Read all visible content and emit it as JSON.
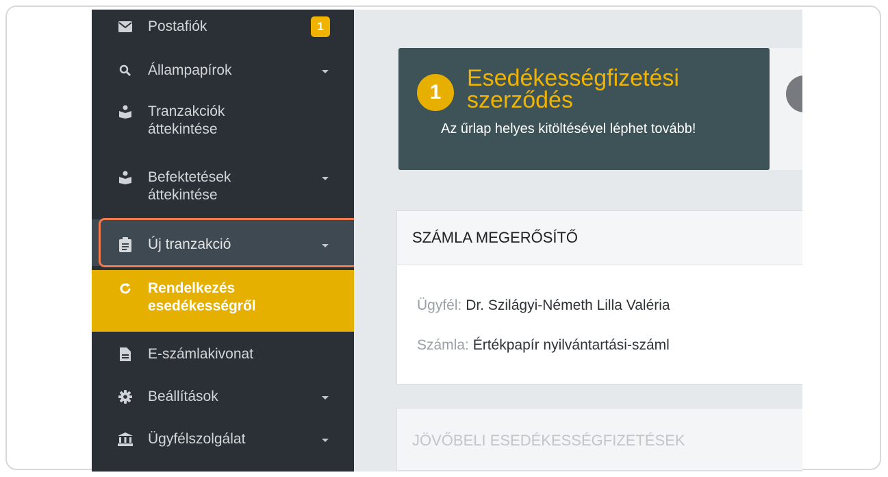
{
  "sidebar": {
    "items": [
      {
        "label": "Postafiók",
        "icon": "mail-icon",
        "badge": "1"
      },
      {
        "label": "Állampapírok",
        "icon": "search-icon",
        "has_submenu": true
      },
      {
        "label": "Tranzakciók\náttekintése",
        "icon": "person-reading-icon"
      },
      {
        "label": "Befektetések\náttekintése",
        "icon": "person-reading-icon",
        "has_submenu": true
      },
      {
        "label": "Új tranzakció",
        "icon": "clipboard-icon",
        "has_submenu": true,
        "highlighted": true
      },
      {
        "label": "Rendelkezés\nesedékességről",
        "icon": "refresh-icon",
        "active": true
      },
      {
        "label": "E-számlakivonat",
        "icon": "document-icon"
      },
      {
        "label": "Beállítások",
        "icon": "gear-icon",
        "has_submenu": true
      },
      {
        "label": "Ügyfélszolgálat",
        "icon": "bank-icon",
        "has_submenu": true
      }
    ]
  },
  "step": {
    "number": "1",
    "title": "Esedékességfizetési szerződés",
    "subtitle": "Az űrlap helyes kitöltésével léphet tovább!"
  },
  "account_panel": {
    "title": "SZÁMLA MEGERŐSÍTŐ",
    "client_label": "Ügyfél:",
    "client_value": "Dr. Szilágyi-Németh Lilla Valéria",
    "account_label": "Számla:",
    "account_value": "Értékpapír nyilvántartási-száml"
  },
  "future_panel": {
    "title": "JÖVŐBELI ESEDÉKESSÉGFIZETÉSEK"
  },
  "colors": {
    "sidebar_bg": "#2a3035",
    "active_bg": "#e5b000",
    "accent": "#f0b400",
    "highlight_border": "#f37a4d",
    "step_card_bg": "#3e5357"
  }
}
